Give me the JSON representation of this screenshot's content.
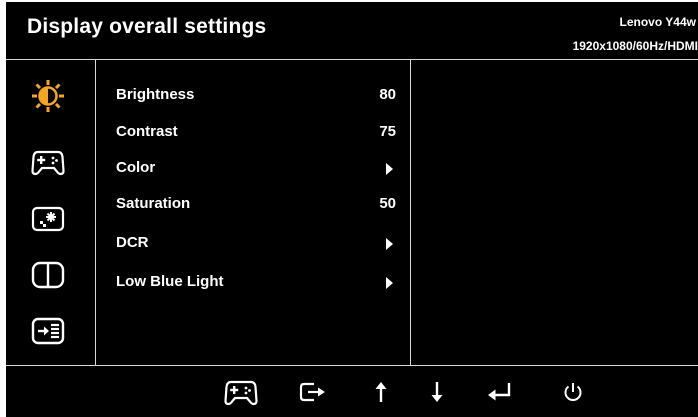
{
  "header": {
    "title": "Display overall settings",
    "model": "Lenovo Y44w",
    "resolution": "1920x1080/60Hz/HDMI"
  },
  "sidebar": {
    "items": [
      {
        "icon": "brightness-icon",
        "active": true,
        "color": "#f5a623"
      },
      {
        "icon": "gamepad-icon",
        "active": false
      },
      {
        "icon": "image-setup-icon",
        "active": false
      },
      {
        "icon": "split-screen-icon",
        "active": false
      },
      {
        "icon": "input-menu-icon",
        "active": false
      }
    ]
  },
  "menu": {
    "items": [
      {
        "label": "Brightness",
        "value": "80"
      },
      {
        "label": "Contrast",
        "value": "75"
      },
      {
        "label": "Color",
        "value": null,
        "submenu": true
      },
      {
        "label": "Saturation",
        "value": "50"
      },
      {
        "label": "DCR",
        "value": null,
        "submenu": true
      },
      {
        "label": "Low Blue Light",
        "value": null,
        "submenu": true
      }
    ]
  },
  "footer": {
    "buttons": [
      {
        "icon": "gamepad-icon"
      },
      {
        "icon": "exit-icon"
      },
      {
        "icon": "arrow-up-icon"
      },
      {
        "icon": "arrow-down-icon"
      },
      {
        "icon": "enter-icon"
      },
      {
        "icon": "power-icon"
      }
    ]
  },
  "colors": {
    "background": "#000000",
    "text": "#ffffff",
    "accent": "#f5a623",
    "divider": "#d8d8d8"
  }
}
